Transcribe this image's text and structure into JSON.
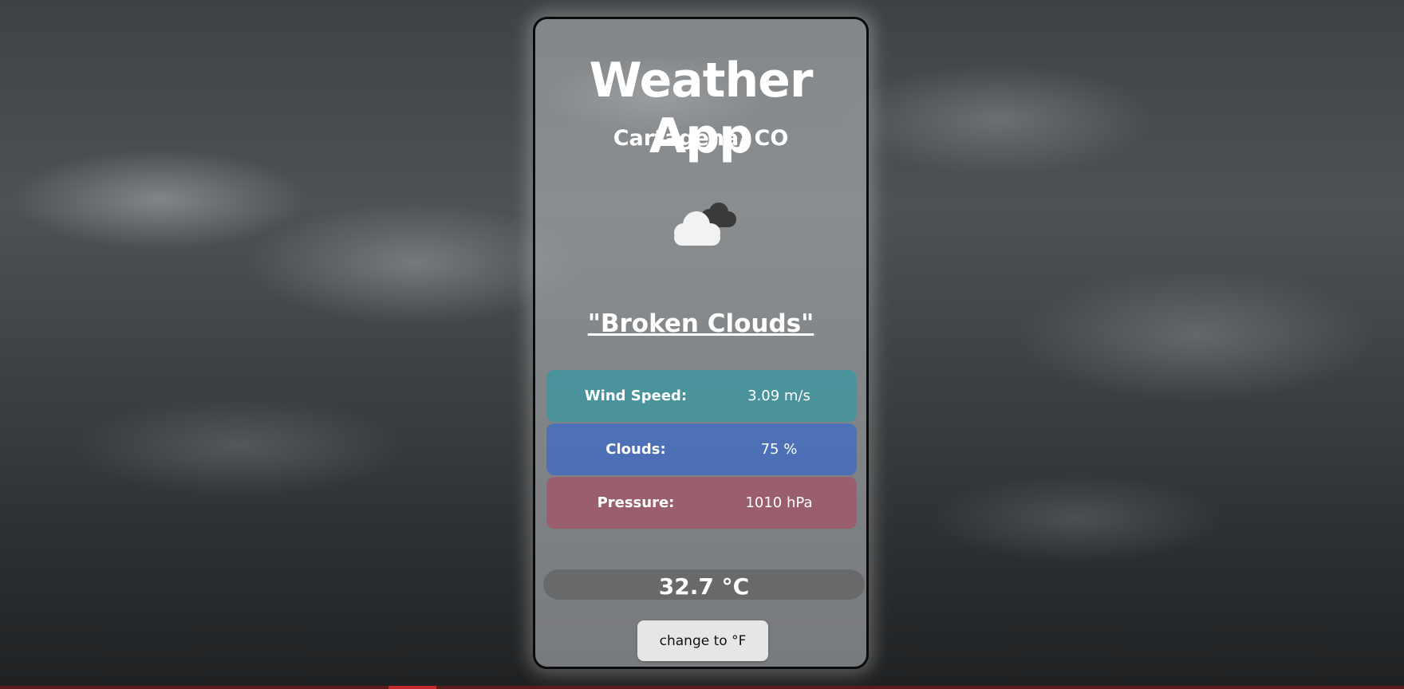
{
  "app": {
    "title": "Weather App",
    "location": "Cartagena/ CO",
    "weather_icon": "broken-clouds-icon",
    "description": "\"Broken Clouds\""
  },
  "stats": {
    "wind": {
      "label": "Wind Speed:",
      "value": "3.09 m/s"
    },
    "clouds": {
      "label": "Clouds:",
      "value": "75 %"
    },
    "pressure": {
      "label": "Pressure:",
      "value": "1010 hPa"
    }
  },
  "temperature": "32.7 °C",
  "unit_toggle": {
    "label": "change to °F"
  },
  "colors": {
    "wind_row": "#3e96a0",
    "clouds_row": "#446cbe",
    "pressure_row": "#a55064"
  }
}
